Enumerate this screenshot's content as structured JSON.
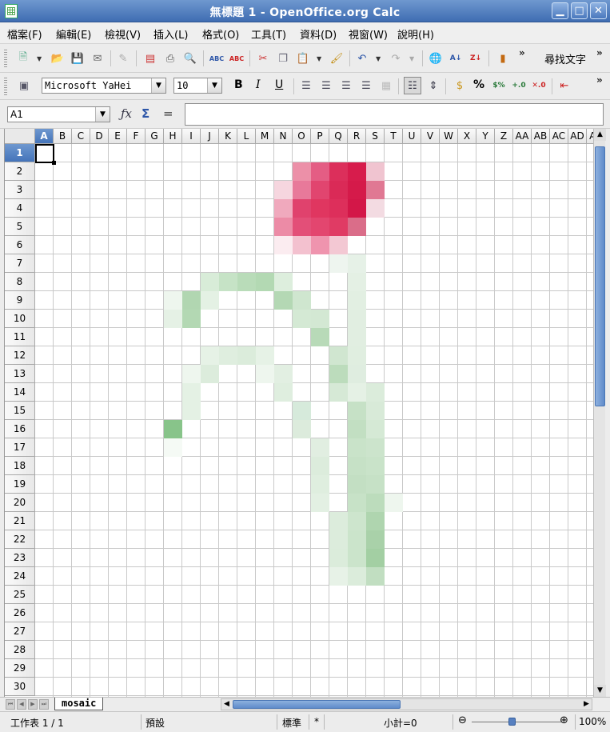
{
  "window": {
    "title": "無標題 1 - OpenOffice.org Calc"
  },
  "menu": [
    "檔案(F)",
    "編輯(E)",
    "檢視(V)",
    "插入(L)",
    "格式(O)",
    "工具(T)",
    "資料(D)",
    "視窗(W)",
    "說明(H)"
  ],
  "toolbar": {
    "find_label": "尋找文字"
  },
  "format_toolbar": {
    "font_name": "Microsoft YaHei",
    "font_size": "10",
    "bold": "B",
    "italic": "I",
    "underline": "U",
    "percent": "%"
  },
  "formula_bar": {
    "cell_ref": "A1",
    "sum": "Σ",
    "equals": "="
  },
  "sheet": {
    "columns": [
      "A",
      "B",
      "C",
      "D",
      "E",
      "F",
      "G",
      "H",
      "I",
      "J",
      "K",
      "L",
      "M",
      "N",
      "O",
      "P",
      "Q",
      "R",
      "S",
      "T",
      "U",
      "V",
      "W",
      "X",
      "Y",
      "Z",
      "AA",
      "AB",
      "AC",
      "AD",
      "AE"
    ],
    "rows": [
      "1",
      "2",
      "3",
      "4",
      "5",
      "6",
      "7",
      "8",
      "9",
      "10",
      "11",
      "12",
      "13",
      "14",
      "15",
      "16",
      "17",
      "18",
      "19",
      "20",
      "21",
      "22",
      "23",
      "24",
      "25",
      "26",
      "27",
      "28",
      "29",
      "30"
    ],
    "active_cell": "A1",
    "tab": "mosaic"
  },
  "statusbar": {
    "sheet_info": "工作表 1 / 1",
    "page_style": "預設",
    "mode": "標準",
    "modified": "*",
    "sum": "小計=0",
    "zoom": "100%"
  },
  "colors": {
    "mosaic": {
      "O2": "#ec90a8",
      "P2": "#e45d84",
      "Q2": "#dc2f5b",
      "R2": "#d71c4c",
      "S2": "#f0c4d0",
      "N3": "#f6d6df",
      "O3": "#e8799a",
      "P3": "#e1456f",
      "Q3": "#da2a57",
      "R3": "#d51a4a",
      "S3": "#e07893",
      "N4": "#f0a9bd",
      "O4": "#e0426d",
      "P4": "#e03660",
      "Q4": "#dd2f5b",
      "R4": "#d31748",
      "S4": "#f3dbe2",
      "N5": "#ec8ba6",
      "O5": "#e34f78",
      "P5": "#e3466f",
      "Q5": "#e03b64",
      "R5": "#da6d89",
      "N6": "#fbecf0",
      "O6": "#f3c1cf",
      "P6": "#ef94ae",
      "Q6": "#f3c8d3",
      "Q7": "#eef5ef",
      "R7": "#e6f1e7",
      "J8": "#d8ecd8",
      "K8": "#c6e3c6",
      "L8": "#b9dcb9",
      "M8": "#b3d9b3",
      "N8": "#ddeedd",
      "R8": "#e4f0e4",
      "H9": "#eef6ee",
      "I9": "#b1d6b1",
      "J9": "#e4f1e4",
      "N9": "#b4d8b4",
      "O9": "#cfe6cf",
      "R9": "#e2efe2",
      "H10": "#e5f1e5",
      "I10": "#b3d8b3",
      "O10": "#d4e9d4",
      "P10": "#d3e8d3",
      "R10": "#e1eee1",
      "P11": "#b8dab8",
      "R11": "#e1eee1",
      "J12": "#e6f2e6",
      "K12": "#dfeedf",
      "L12": "#dbecdb",
      "M12": "#e6f2e6",
      "Q12": "#d0e6d0",
      "R12": "#e0eee0",
      "I13": "#eef6ee",
      "J13": "#dcecdc",
      "M13": "#eef6ee",
      "N13": "#e2efe2",
      "Q13": "#bcdcbc",
      "R13": "#dfede0",
      "I14": "#e4f1e4",
      "N14": "#dfeedf",
      "Q14": "#d6e9d6",
      "R14": "#e5f1e5",
      "S14": "#dbecdb",
      "I15": "#e4f1e4",
      "O15": "#d6eadb",
      "R15": "#c6e1c6",
      "S15": "#d8ead8",
      "H16": "#88c48a",
      "O16": "#dcebdc",
      "R16": "#c2dfc2",
      "S16": "#d5e9d5",
      "H17": "#f5faf5",
      "P17": "#e1eee1",
      "R17": "#c9e3c9",
      "S17": "#cce4cc",
      "P18": "#dcecdc",
      "R18": "#c6e1c6",
      "S18": "#c9e3c9",
      "P19": "#dfeedf",
      "R19": "#c3dfc3",
      "S19": "#c6e1c6",
      "P20": "#e3f0e3",
      "R20": "#c7e2c7",
      "S20": "#bcdcbc",
      "T20": "#eef6ee",
      "Q21": "#dcecdc",
      "R21": "#cde5cd",
      "S21": "#afd5af",
      "Q22": "#dcecdc",
      "R22": "#cbe4cb",
      "S22": "#a9d1a9",
      "Q23": "#dbecdb",
      "R23": "#cbe4cb",
      "S23": "#a3cfa3",
      "Q24": "#e7f2e7",
      "R24": "#dbecdb",
      "S24": "#c1dec1"
    }
  }
}
